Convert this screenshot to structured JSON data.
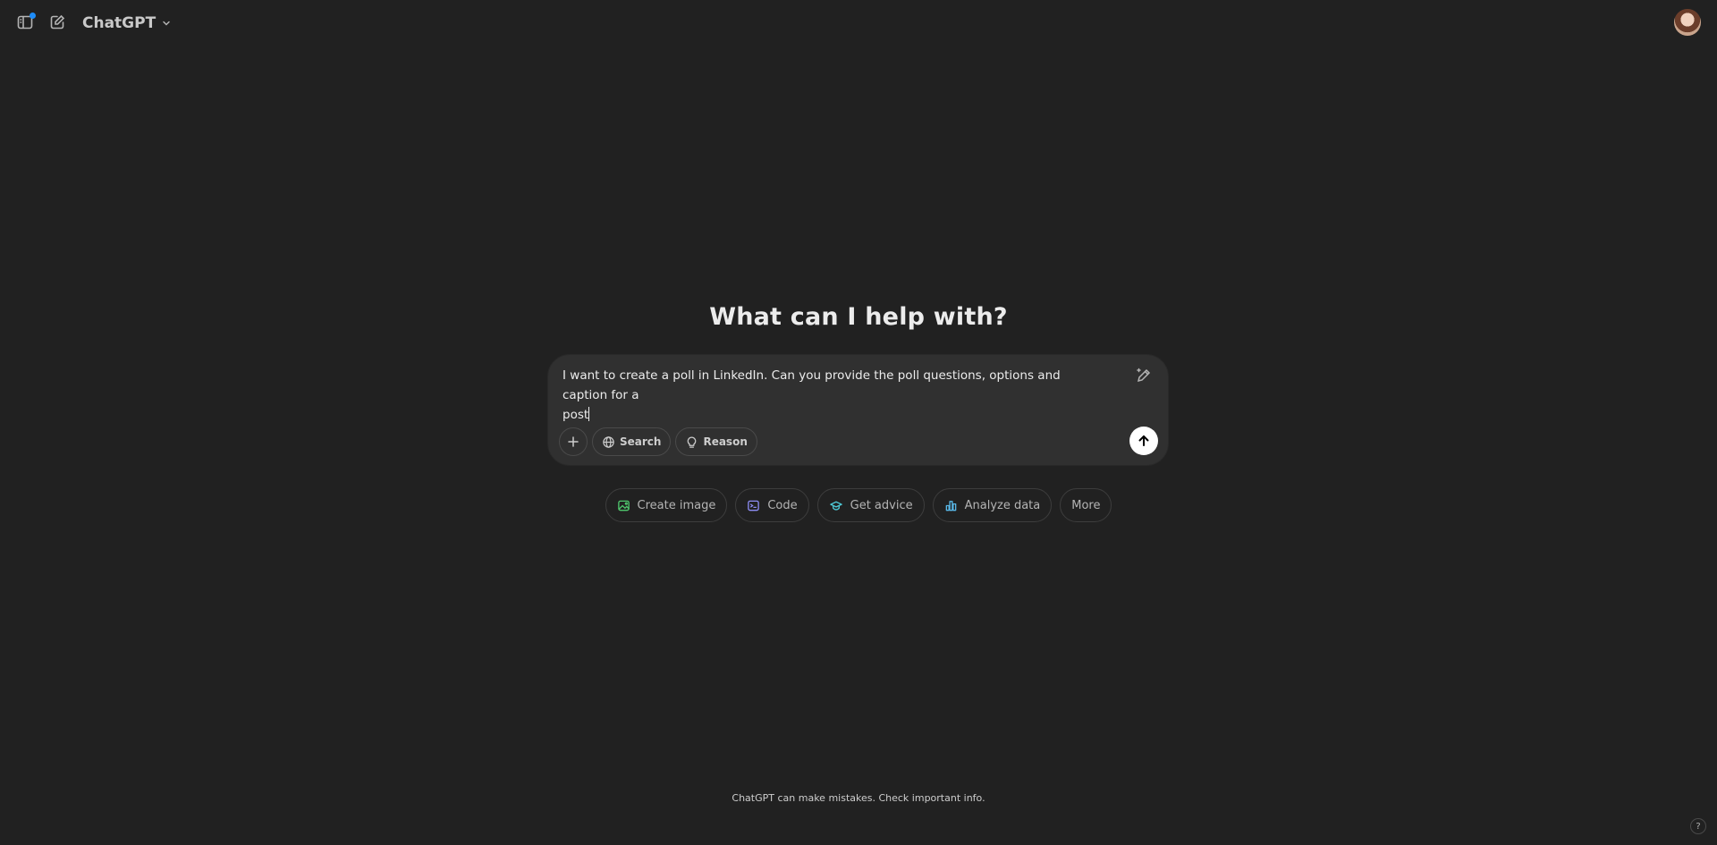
{
  "header": {
    "model_name": "ChatGPT",
    "sidebar_icon": "sidebar-toggle-icon",
    "new_chat_icon": "compose-icon"
  },
  "main": {
    "headline": "What can I help with?"
  },
  "composer": {
    "text_line1": "I want to create a poll in LinkedIn. Can you provide the poll questions, options and caption for a",
    "text_line2": "post",
    "tools": {
      "search_label": "Search",
      "reason_label": "Reason"
    }
  },
  "suggestions": [
    {
      "label": "Create image",
      "icon": "image-icon",
      "color": "#4fc76d"
    },
    {
      "label": "Code",
      "icon": "terminal-icon",
      "color": "#8d8df5"
    },
    {
      "label": "Get advice",
      "icon": "graduation-cap-icon",
      "color": "#4ec9d6"
    },
    {
      "label": "Analyze data",
      "icon": "chart-icon",
      "color": "#58b8e8"
    },
    {
      "label": "More",
      "icon": "",
      "color": "#b4b4b4"
    }
  ],
  "footer": {
    "disclaimer": "ChatGPT can make mistakes. Check important info.",
    "help_label": "?"
  },
  "colors": {
    "background": "#212121",
    "composer": "#303030",
    "accent_dot": "#1d8cf8"
  }
}
